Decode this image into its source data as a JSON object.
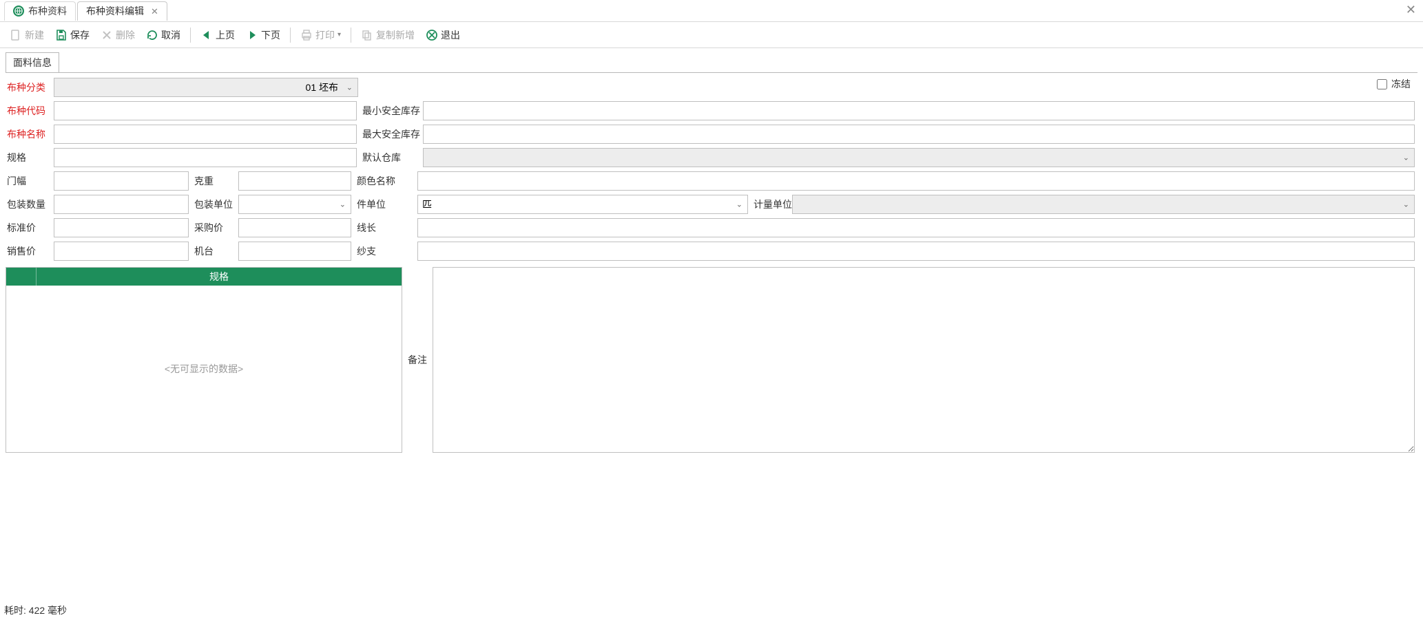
{
  "tabs": {
    "inactive_label": "布种资料",
    "active_label": "布种资料编辑"
  },
  "toolbar": {
    "new": "新建",
    "save": "保存",
    "delete": "删除",
    "cancel": "取消",
    "prev": "上页",
    "next": "下页",
    "print": "打印",
    "copy_new": "复制新增",
    "exit": "退出"
  },
  "inner_tab": "面料信息",
  "freeze_label": "冻结",
  "labels": {
    "category": "布种分类",
    "code": "布种代码",
    "name": "布种名称",
    "spec": "规格",
    "width": "门幅",
    "weight": "克重",
    "pack_qty": "包装数量",
    "pack_unit": "包装单位",
    "std_price": "标准价",
    "buy_price": "采购价",
    "sale_price": "销售价",
    "machine": "机台",
    "min_stock": "最小安全库存",
    "max_stock": "最大安全库存",
    "def_wh": "默认仓库",
    "color": "颜色名称",
    "piece_unit": "件单位",
    "measure_unit": "计量单位",
    "thread_len": "线长",
    "yarn": "纱支",
    "remark": "备注"
  },
  "values": {
    "category": "01 坯布",
    "code": "",
    "name": "",
    "spec": "",
    "width": "",
    "weight": "",
    "pack_qty": "",
    "pack_unit": "",
    "std_price": "",
    "buy_price": "",
    "sale_price": "",
    "machine": "",
    "min_stock": "",
    "max_stock": "",
    "def_wh": "",
    "color": "",
    "piece_unit": "匹",
    "measure_unit": "",
    "thread_len": "",
    "yarn": "",
    "remark": ""
  },
  "spec_table": {
    "header": "规格",
    "empty": "<无可显示的数据>"
  },
  "status": "耗时: 422 毫秒"
}
